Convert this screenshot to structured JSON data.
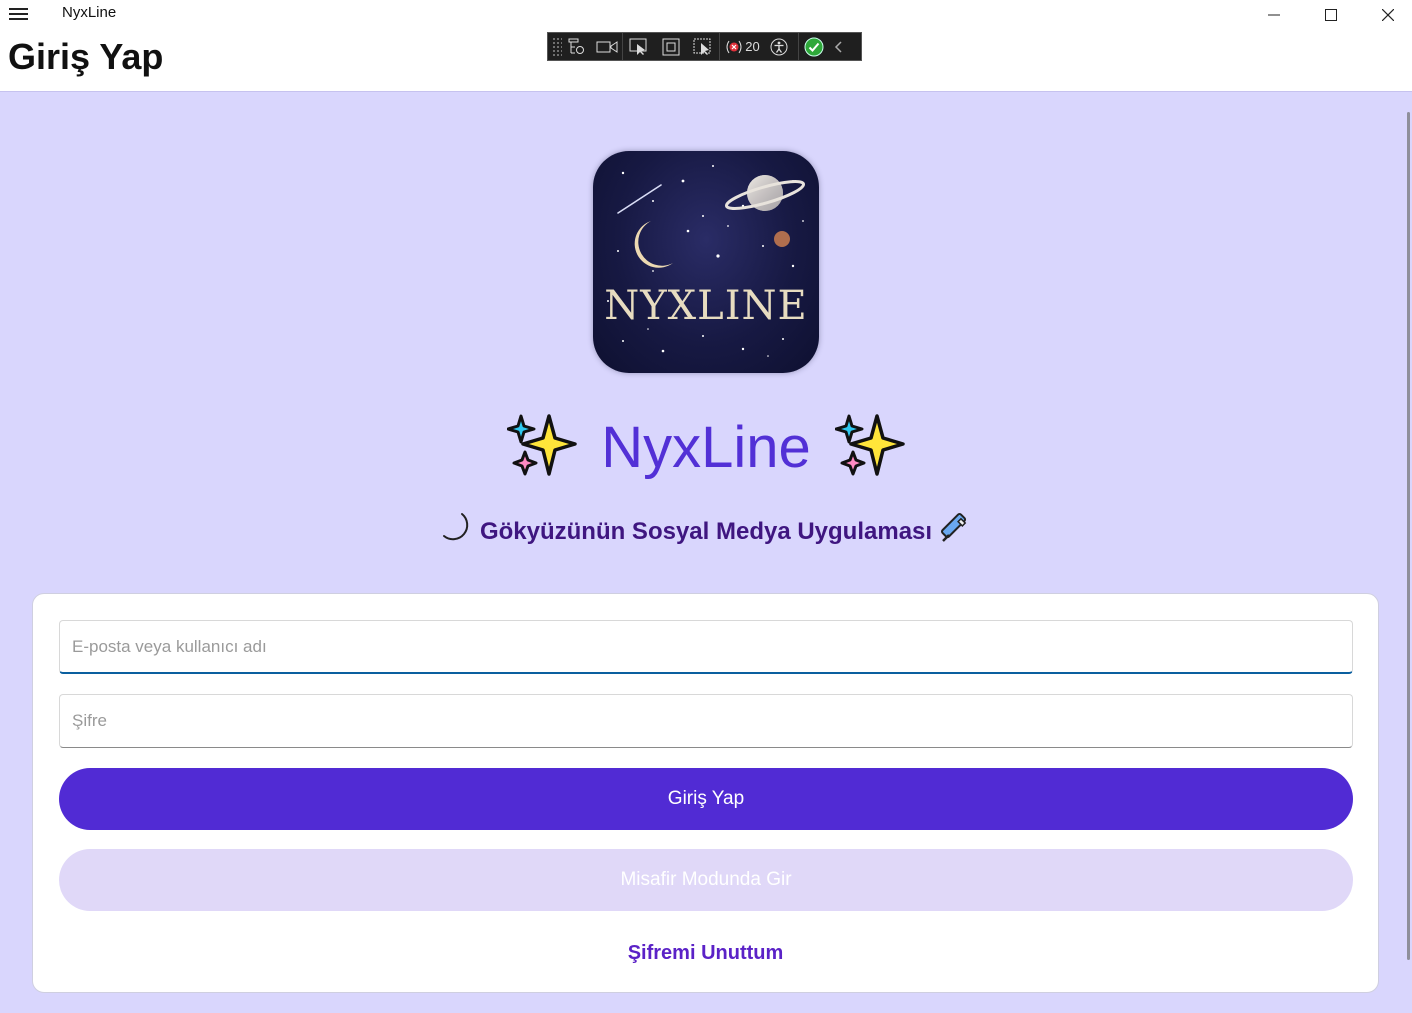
{
  "window": {
    "app_title": "NyxLine",
    "minimize_icon": "minimize-icon",
    "maximize_icon": "maximize-icon",
    "close_icon": "close-icon"
  },
  "header": {
    "page_title": "Giriş Yap"
  },
  "debug_toolbar": {
    "icons": [
      "live-visual-tree-icon",
      "video-icon",
      "select-element-icon",
      "display-layout-adorners-icon",
      "track-focus-icon",
      "binding-failures-icon",
      "accessibility-icon",
      "check-icon",
      "collapse-chevron-icon"
    ],
    "binding_failures_count": "20"
  },
  "logo": {
    "wordmark": "NYXLINE"
  },
  "brand": {
    "name": "NyxLine",
    "sparkle": "✨"
  },
  "subtitle": {
    "moon": "🌙",
    "text": "Gökyüzünün Sosyal Medya Uygulaması",
    "telescope": "🔭"
  },
  "form": {
    "email_placeholder": "E-posta veya kullanıcı adı",
    "email_value": "",
    "password_placeholder": "Şifre",
    "password_value": "",
    "login_label": "Giriş Yap",
    "guest_label": "Misafir Modunda Gir",
    "forgot_label": "Şifremi Unuttum"
  },
  "colors": {
    "background": "#d9d6fd",
    "primary": "#512bd4",
    "brand_text": "#5230d6",
    "subtitle_text": "#3f1680",
    "guest_button": "#e0d8f8"
  }
}
